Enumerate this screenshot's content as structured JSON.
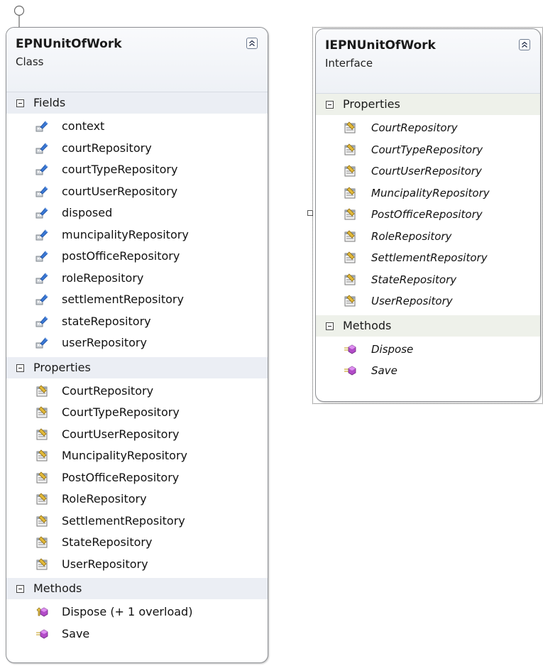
{
  "class_shape": {
    "name": "EPNUnitOfWork",
    "stereotype": "Class",
    "sections": [
      {
        "title": "Fields",
        "icon": "field-icon",
        "items": [
          "context",
          "courtRepository",
          "courtTypeRepository",
          "courtUserRepository",
          "disposed",
          "muncipalityRepository",
          "postOfficeRepository",
          "roleRepository",
          "settlementRepository",
          "stateRepository",
          "userRepository"
        ]
      },
      {
        "title": "Properties",
        "icon": "property-icon",
        "items": [
          "CourtRepository",
          "CourtTypeRepository",
          "CourtUserRepository",
          "MuncipalityRepository",
          "PostOfficeRepository",
          "RoleRepository",
          "SettlementRepository",
          "StateRepository",
          "UserRepository"
        ]
      },
      {
        "title": "Methods",
        "icon": "method-icon",
        "items": [
          "Dispose (+ 1 overload)",
          "Save"
        ],
        "item_icons": [
          "protected-method-icon",
          "method-icon"
        ]
      }
    ]
  },
  "interface_shape": {
    "name": "IEPNUnitOfWork",
    "stereotype": "Interface",
    "sections": [
      {
        "title": "Properties",
        "icon": "property-icon",
        "items": [
          "CourtRepository",
          "CourtTypeRepository",
          "CourtUserRepository",
          "MuncipalityRepository",
          "PostOfficeRepository",
          "RoleRepository",
          "SettlementRepository",
          "StateRepository",
          "UserRepository"
        ]
      },
      {
        "title": "Methods",
        "icon": "method-icon",
        "items": [
          "Dispose",
          "Save"
        ],
        "item_icons": [
          "method-icon",
          "method-icon"
        ]
      }
    ]
  },
  "colors": {
    "border": "#8d8f93",
    "header_bg": "#f3f5f9",
    "class_section_bg": "#ebeef4",
    "interface_section_bg": "#eef1ea"
  }
}
